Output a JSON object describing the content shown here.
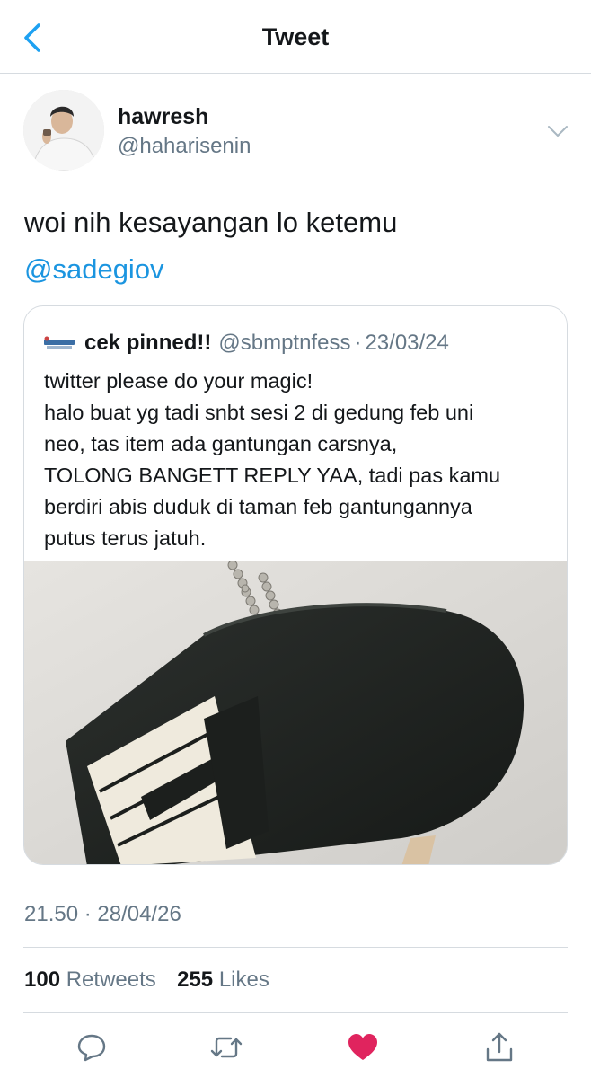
{
  "header": {
    "title": "Tweet",
    "back_icon": "chevron-left-icon",
    "accent": "#1da1f2"
  },
  "tweet": {
    "author": {
      "name": "hawresh",
      "handle": "@haharisenin"
    },
    "text": "woi nih kesayangan lo ketemu",
    "mention": "@sadegiov",
    "timestamp": "21.50 · 28/04/26",
    "retweets": {
      "count": "100",
      "label": "Retweets"
    },
    "likes": {
      "count": "255",
      "label": "Likes"
    }
  },
  "quote": {
    "name": "cek pinned!!",
    "handle": "@sbmptnfess",
    "separator": "·",
    "date": "23/03/24",
    "lines": [
      "twitter please do your magic!",
      "halo buat yg tadi snbt sesi 2 di gedung feb uni",
      "neo, tas item ada gantungan carsnya,",
      "TOLONG BANGETT REPLY YAA, tadi pas kamu",
      "berdiri abis duduk di taman feb gantungannya",
      "putus terus jatuh."
    ],
    "media_description": "black piano-shaped keychain on ball chain"
  },
  "actions": {
    "reply": "reply-icon",
    "retweet": "retweet-icon",
    "like": "heart-icon",
    "like_color": "#e0245e",
    "share": "share-icon"
  },
  "colors": {
    "text": "#14171a",
    "secondary": "#657786",
    "link": "#1b95e0",
    "border": "#d6dbe0"
  }
}
